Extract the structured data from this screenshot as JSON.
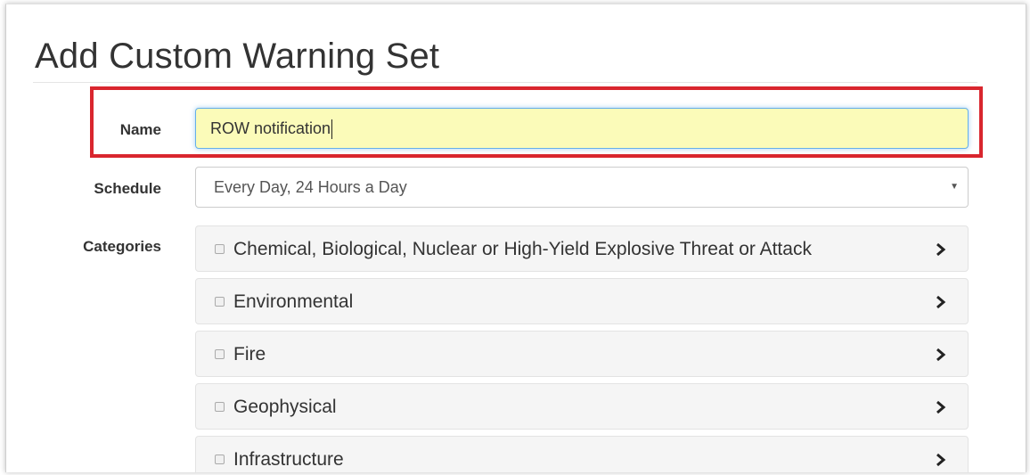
{
  "page": {
    "title": "Add Custom Warning Set"
  },
  "form": {
    "name_label": "Name",
    "name_value": "ROW notification",
    "schedule_label": "Schedule",
    "schedule_value": "Every Day, 24 Hours a Day",
    "categories_label": "Categories"
  },
  "categories": [
    {
      "label": "Chemical, Biological, Nuclear or High-Yield Explosive Threat or Attack",
      "checked": false
    },
    {
      "label": "Environmental",
      "checked": false
    },
    {
      "label": "Fire",
      "checked": false
    },
    {
      "label": "Geophysical",
      "checked": false
    },
    {
      "label": "Infrastructure",
      "checked": false
    }
  ],
  "colors": {
    "highlight_border": "#d9262e",
    "name_input_bg": "#fbfbb9",
    "focus_border": "#66afe9"
  },
  "icons": {
    "category_expand": "chevron-right-icon",
    "select_arrow": "caret-down-icon"
  }
}
